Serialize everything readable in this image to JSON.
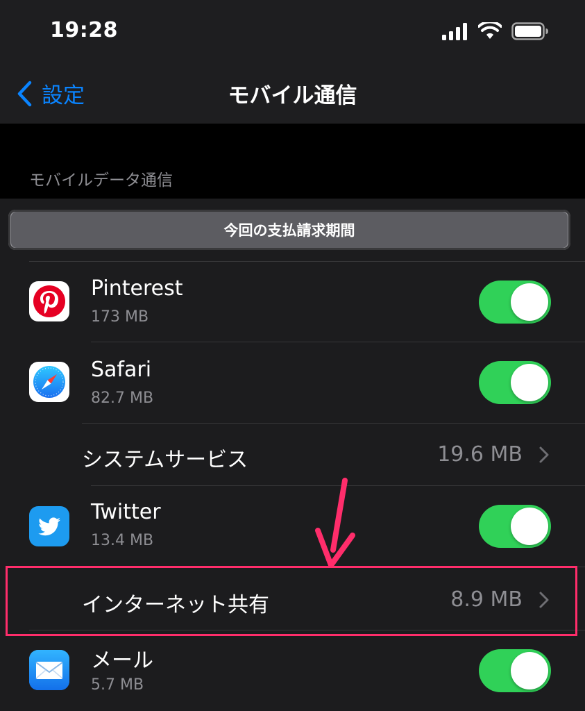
{
  "status_bar": {
    "time": "19:28"
  },
  "nav": {
    "back_label": "設定",
    "title": "モバイル通信"
  },
  "section": {
    "header": "モバイルデータ通信"
  },
  "segment": {
    "label": "今回の支払請求期間"
  },
  "rows": [
    {
      "type": "app",
      "name": "Pinterest",
      "size": "173 MB",
      "enabled": true,
      "icon": "pinterest-icon",
      "color": "#e60023"
    },
    {
      "type": "app",
      "name": "Safari",
      "size": "82.7 MB",
      "enabled": true,
      "icon": "safari-icon",
      "color": "#1a8cff"
    },
    {
      "type": "link",
      "label": "システムサービス",
      "value": "19.6 MB"
    },
    {
      "type": "app",
      "name": "Twitter",
      "size": "13.4 MB",
      "enabled": true,
      "icon": "twitter-icon",
      "color": "#1d9bf0"
    },
    {
      "type": "link",
      "label": "インターネット共有",
      "value": "8.9 MB",
      "highlighted": true
    },
    {
      "type": "app",
      "name": "メール",
      "size": "5.7 MB",
      "enabled": true,
      "icon": "mail-icon",
      "color": "#1e8cf5"
    }
  ],
  "colors": {
    "accent": "#0a84ff",
    "toggle_on": "#30d158",
    "annotation": "#ff2d6b"
  }
}
